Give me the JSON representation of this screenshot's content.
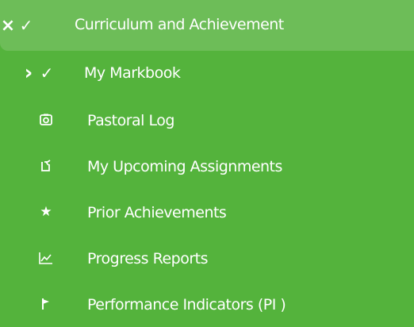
{
  "menu": {
    "header": {
      "collapse_glyph": "×",
      "check_glyph": "✓",
      "label": "Curriculum and Achievement"
    },
    "items": [
      {
        "label": "My Markbook",
        "expand_glyph": "›",
        "check_glyph": "✓",
        "icon": "chevron-right-icon"
      },
      {
        "label": "Pastoral Log",
        "icon": "camera-icon"
      },
      {
        "label": "My Upcoming Assignments",
        "icon": "assignment-hand-icon"
      },
      {
        "label": "Prior Achievements",
        "icon": "star-icon",
        "icon_glyph": "★"
      },
      {
        "label": "Progress Reports",
        "icon": "line-chart-icon"
      },
      {
        "label": "Performance Indicators (PI )",
        "icon": "flag-icon"
      }
    ]
  },
  "colors": {
    "menu_background": "#54b33c",
    "header_background": "#6dbd58",
    "text": "#ffffff"
  }
}
